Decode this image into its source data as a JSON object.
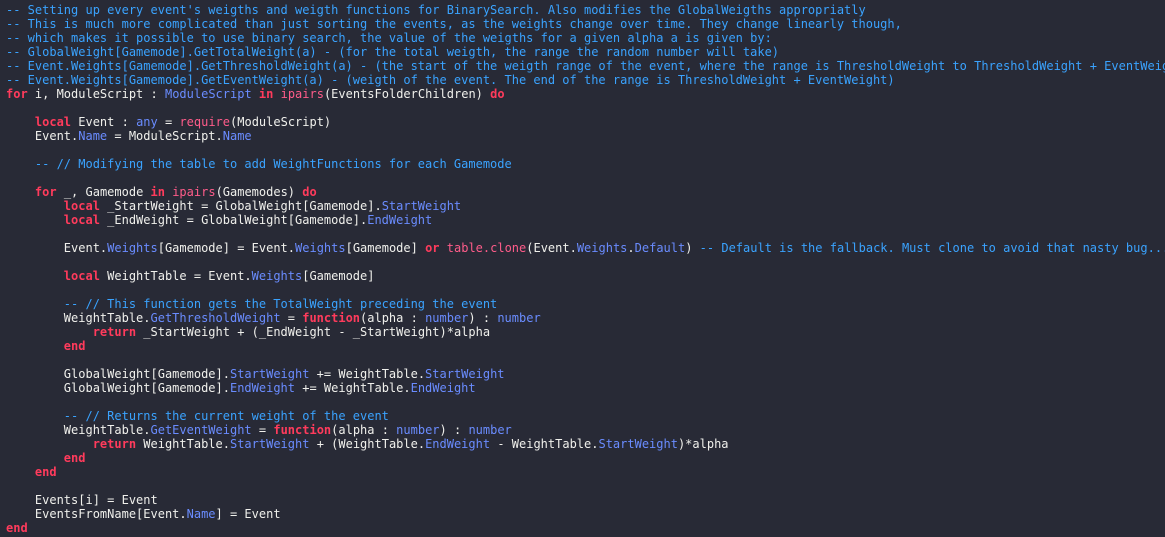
{
  "theme": {
    "background": "#282a36",
    "comment": "#3aa3ff",
    "keyword": "#ff3b5c",
    "property": "#6a8cff",
    "builtin": "#ff5c8a",
    "type": "#6a8cff",
    "plain": "#f0f0ec"
  },
  "code": {
    "lines": [
      [
        [
          "comment",
          "-- Setting up every event's weigths and weigth functions for BinarySearch. Also modifies the GlobalWeigths appropriatly"
        ]
      ],
      [
        [
          "comment",
          "-- This is much more complicated than just sorting the events, as the weights change over time. They change linearly though,"
        ]
      ],
      [
        [
          "comment",
          "-- which makes it possible to use binary search, the value of the weigths for a given alpha a is given by:"
        ]
      ],
      [
        [
          "comment",
          "-- GlobalWeight[Gamemode].GetTotalWeight(a) - (for the total weigth, the range the random number will take)"
        ]
      ],
      [
        [
          "comment",
          "-- Event.Weights[Gamemode].GetThresholdWeight(a) - (the start of the weigth range of the event, where the range is ThresholdWeight to ThresholdWeight + EventWeight)"
        ]
      ],
      [
        [
          "comment",
          "-- Event.Weights[Gamemode].GetEventWeight(a) - (weigth of the event. The end of the range is ThresholdWeight + EventWeight)"
        ]
      ],
      [
        [
          "keyword",
          "for"
        ],
        [
          "plain",
          " i, ModuleScript : "
        ],
        [
          "type",
          "ModuleScript"
        ],
        [
          "plain",
          " "
        ],
        [
          "keyword",
          "in"
        ],
        [
          "plain",
          " "
        ],
        [
          "builtin",
          "ipairs"
        ],
        [
          "plain",
          "(EventsFolderChildren) "
        ],
        [
          "keyword",
          "do"
        ]
      ],
      [],
      [
        [
          "plain",
          "    "
        ],
        [
          "keyword",
          "local"
        ],
        [
          "plain",
          " Event : "
        ],
        [
          "type",
          "any"
        ],
        [
          "plain",
          " = "
        ],
        [
          "builtin",
          "require"
        ],
        [
          "plain",
          "(ModuleScript)"
        ]
      ],
      [
        [
          "plain",
          "    Event."
        ],
        [
          "property",
          "Name"
        ],
        [
          "plain",
          " = ModuleScript."
        ],
        [
          "property",
          "Name"
        ]
      ],
      [],
      [
        [
          "plain",
          "    "
        ],
        [
          "comment",
          "-- // Modifying the table to add WeightFunctions for each Gamemode"
        ]
      ],
      [],
      [
        [
          "plain",
          "    "
        ],
        [
          "keyword",
          "for"
        ],
        [
          "plain",
          " _, Gamemode "
        ],
        [
          "keyword",
          "in"
        ],
        [
          "plain",
          " "
        ],
        [
          "builtin",
          "ipairs"
        ],
        [
          "plain",
          "(Gamemodes) "
        ],
        [
          "keyword",
          "do"
        ]
      ],
      [
        [
          "plain",
          "        "
        ],
        [
          "keyword",
          "local"
        ],
        [
          "plain",
          " _StartWeight = GlobalWeight[Gamemode]."
        ],
        [
          "property",
          "StartWeight"
        ]
      ],
      [
        [
          "plain",
          "        "
        ],
        [
          "keyword",
          "local"
        ],
        [
          "plain",
          " _EndWeight = GlobalWeight[Gamemode]."
        ],
        [
          "property",
          "EndWeight"
        ]
      ],
      [],
      [
        [
          "plain",
          "        Event."
        ],
        [
          "property",
          "Weights"
        ],
        [
          "plain",
          "[Gamemode] = Event."
        ],
        [
          "property",
          "Weights"
        ],
        [
          "plain",
          "[Gamemode] "
        ],
        [
          "keyword",
          "or"
        ],
        [
          "plain",
          " "
        ],
        [
          "builtin",
          "table.clone"
        ],
        [
          "plain",
          "(Event."
        ],
        [
          "property",
          "Weights"
        ],
        [
          "plain",
          "."
        ],
        [
          "property",
          "Default"
        ],
        [
          "plain",
          ") "
        ],
        [
          "comment",
          "-- Default is the fallback. Must clone to avoid that nasty bug..."
        ]
      ],
      [],
      [
        [
          "plain",
          "        "
        ],
        [
          "keyword",
          "local"
        ],
        [
          "plain",
          " WeightTable = Event."
        ],
        [
          "property",
          "Weights"
        ],
        [
          "plain",
          "[Gamemode]"
        ]
      ],
      [],
      [
        [
          "plain",
          "        "
        ],
        [
          "comment",
          "-- // This function gets the TotalWeight preceding the event"
        ]
      ],
      [
        [
          "plain",
          "        WeightTable."
        ],
        [
          "property",
          "GetThresholdWeight"
        ],
        [
          "plain",
          " = "
        ],
        [
          "keyword",
          "function"
        ],
        [
          "plain",
          "(alpha : "
        ],
        [
          "type",
          "number"
        ],
        [
          "plain",
          ") : "
        ],
        [
          "type",
          "number"
        ]
      ],
      [
        [
          "plain",
          "            "
        ],
        [
          "keyword",
          "return"
        ],
        [
          "plain",
          " _StartWeight + (_EndWeight - _StartWeight)*alpha"
        ]
      ],
      [
        [
          "plain",
          "        "
        ],
        [
          "keyword",
          "end"
        ]
      ],
      [],
      [
        [
          "plain",
          "        GlobalWeight[Gamemode]."
        ],
        [
          "property",
          "StartWeight"
        ],
        [
          "plain",
          " += WeightTable."
        ],
        [
          "property",
          "StartWeight"
        ]
      ],
      [
        [
          "plain",
          "        GlobalWeight[Gamemode]."
        ],
        [
          "property",
          "EndWeight"
        ],
        [
          "plain",
          " += WeightTable."
        ],
        [
          "property",
          "EndWeight"
        ]
      ],
      [],
      [
        [
          "plain",
          "        "
        ],
        [
          "comment",
          "-- // Returns the current weight of the event"
        ]
      ],
      [
        [
          "plain",
          "        WeightTable."
        ],
        [
          "property",
          "GetEventWeight"
        ],
        [
          "plain",
          " = "
        ],
        [
          "keyword",
          "function"
        ],
        [
          "plain",
          "(alpha : "
        ],
        [
          "type",
          "number"
        ],
        [
          "plain",
          ") : "
        ],
        [
          "type",
          "number"
        ]
      ],
      [
        [
          "plain",
          "            "
        ],
        [
          "keyword",
          "return"
        ],
        [
          "plain",
          " WeightTable."
        ],
        [
          "property",
          "StartWeight"
        ],
        [
          "plain",
          " + (WeightTable."
        ],
        [
          "property",
          "EndWeight"
        ],
        [
          "plain",
          " - WeightTable."
        ],
        [
          "property",
          "StartWeight"
        ],
        [
          "plain",
          ")*alpha"
        ]
      ],
      [
        [
          "plain",
          "        "
        ],
        [
          "keyword",
          "end"
        ]
      ],
      [
        [
          "plain",
          "    "
        ],
        [
          "keyword",
          "end"
        ]
      ],
      [],
      [
        [
          "plain",
          "    Events[i] = Event"
        ]
      ],
      [
        [
          "plain",
          "    EventsFromName[Event."
        ],
        [
          "property",
          "Name"
        ],
        [
          "plain",
          "] = Event"
        ]
      ],
      [
        [
          "keyword",
          "end"
        ]
      ]
    ]
  }
}
